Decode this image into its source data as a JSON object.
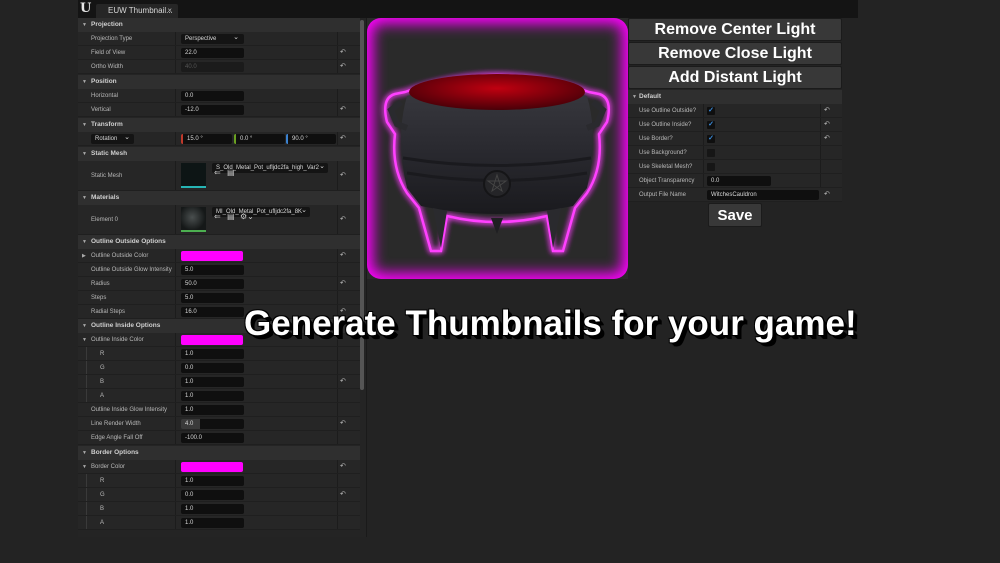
{
  "titlebar": {
    "logo": "U",
    "tab_label": "EUW Thumbnail...",
    "tab_close": "×"
  },
  "left_panel": {
    "projection": {
      "header": "Projection",
      "projection_type_label": "Projection Type",
      "projection_type_value": "Perspective",
      "fov_label": "Field of View",
      "fov_value": "22.0",
      "ortho_label": "Ortho Width",
      "ortho_value": "40.0"
    },
    "position": {
      "header": "Position",
      "horizontal_label": "Horizontal",
      "horizontal_value": "0.0",
      "vertical_label": "Vertical",
      "vertical_value": "-12.0"
    },
    "transform": {
      "header": "Transform",
      "mode": "Rotation",
      "x": "15.0 °",
      "y": "0.0 °",
      "z": "90.0 °"
    },
    "static_mesh": {
      "header": "Static Mesh",
      "label": "Static Mesh",
      "asset": "S_Old_Metal_Pot_ufljdc2fa_high_Var2"
    },
    "materials": {
      "header": "Materials",
      "label": "Element 0",
      "asset": "MI_Old_Metal_Pot_ufljdc2fa_8K"
    },
    "outline_outside": {
      "header": "Outline Outside Options",
      "color_label": "Outline Outside Color",
      "color": "#ff00ff",
      "glow_label": "Outline Outside Glow Intensity",
      "glow_value": "5.0",
      "radius_label": "Radius",
      "radius_value": "50.0",
      "steps_label": "Steps",
      "steps_value": "5.0",
      "radial_label": "Radial Steps",
      "radial_value": "16.0"
    },
    "outline_inside": {
      "header": "Outline Inside Options",
      "color_label": "Outline Inside Color",
      "color": "#ff00ff",
      "r_label": "R",
      "r": "1.0",
      "g_label": "G",
      "g": "0.0",
      "b_label": "B",
      "b": "1.0",
      "a_label": "A",
      "a": "1.0",
      "glow_label": "Outline Inside Glow Intensity",
      "glow_value": "1.0",
      "line_label": "Line Render Width",
      "line_value": "4.0",
      "edge_label": "Edge Angle Fall Off",
      "edge_value": "-100.0"
    },
    "border": {
      "header": "Border Options",
      "color_label": "Border Color",
      "color": "#ff00ff",
      "r_label": "R",
      "r": "1.0",
      "g_label": "G",
      "g": "0.0",
      "b_label": "B",
      "b": "1.0",
      "a_label": "A",
      "a": "1.0"
    }
  },
  "buttons": {
    "remove_center": "Remove Center Light",
    "remove_close": "Remove Close Light",
    "add_distant": "Add Distant Light",
    "save": "Save"
  },
  "right_panel": {
    "header": "Default",
    "use_outline_outside_label": "Use Outline Outside?",
    "use_outline_outside": true,
    "use_outline_inside_label": "Use Outline Inside?",
    "use_outline_inside": true,
    "use_border_label": "Use Border?",
    "use_border": true,
    "use_background_label": "Use Background?",
    "use_background": false,
    "use_skeletal_label": "Use Skeletal Mesh?",
    "use_skeletal": false,
    "transparency_label": "Object Transparency",
    "transparency_value": "0.0",
    "output_label": "Output File Name",
    "output_value": "WitchesCauldron"
  },
  "headline": "Generate Thumbnails for your game!",
  "icons": {
    "reset": "↶",
    "check": "✓",
    "tri_down": "▼",
    "tri_right": "▶",
    "chevron": "⌄"
  }
}
